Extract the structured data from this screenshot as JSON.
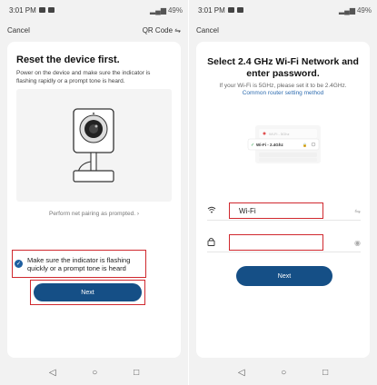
{
  "status": {
    "time": "3:01 PM",
    "battery": "49%"
  },
  "left": {
    "nav": {
      "cancel": "Cancel",
      "qr": "QR Code",
      "qr_icon": "switch-icon"
    },
    "title": "Reset the device first.",
    "description": "Power on the device and make sure the indicator is flashing rapidly or a prompt tone is heard.",
    "hint": "Perform net pairing as prompted. ›",
    "confirm_text": "Make sure the indicator is flashing quickly or a prompt tone is heard",
    "confirm_checked": true,
    "next": "Next"
  },
  "right": {
    "nav": {
      "cancel": "Cancel"
    },
    "title": "Select 2.4 GHz Wi-Fi Network and enter password.",
    "description": "If your Wi-Fi is 5GHz, please set it to be 2.4GHz.",
    "link": "Common router setting method",
    "router_rows": [
      {
        "label": "Wi-Fi - 5Ghz",
        "selected": false
      },
      {
        "label": "Wi-Fi - 2.4Ghz",
        "selected": true
      }
    ],
    "wifi_field": {
      "value": "Wi-Fi",
      "icon": "wifi-icon",
      "trail_icon": "switch-icon"
    },
    "password_field": {
      "value": "",
      "icon": "lock-icon",
      "trail_icon": "eye-icon"
    },
    "next": "Next"
  },
  "colors": {
    "accent": "#154f86",
    "highlight": "#d0282e",
    "link": "#2f6db0"
  }
}
